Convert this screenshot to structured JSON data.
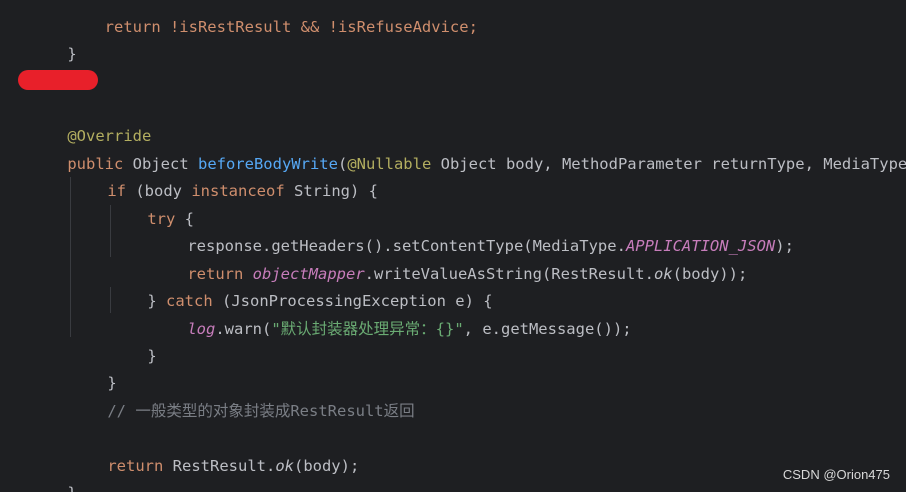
{
  "code": {
    "top_fragment": "    return !isRestResult && !isRefuseAdvice;",
    "line_close_1": "}",
    "annotation": "@Override",
    "sig_public": "public",
    "sig_object": " Object ",
    "sig_method": "beforeBodyWrite",
    "sig_paren": "(",
    "sig_nullable": "@Nullable",
    "sig_rest": " Object body, MethodParameter returnType, MediaType",
    "if_kw": "if",
    "if_mid": " (body ",
    "instanceof_kw": "instanceof",
    "if_end": " String) {",
    "try_kw": "try",
    "try_end": " {",
    "resp_pre": "response.getHeaders().setContentType(MediaType.",
    "resp_const": "APPLICATION_JSON",
    "resp_end": ");",
    "return_kw": "return",
    "ret_sp": " ",
    "ret_field": "objectMapper",
    "ret_mid": ".writeValueAsString(RestResult.",
    "ret_ok": "ok",
    "ret_end": "(body));",
    "catch_pre": "} ",
    "catch_kw": "catch",
    "catch_end": " (JsonProcessingException e) {",
    "log_field": "log",
    "log_mid": ".warn(",
    "log_str": "\"默认封装器处理异常：{}\"",
    "log_end": ", e.getMessage());",
    "close_try": "}",
    "close_if": "}",
    "comment": "// 一般类型的对象封装成RestResult返回",
    "final_return_kw": "return",
    "final_mid": " RestResult.",
    "final_ok": "ok",
    "final_end": "(body);",
    "close_method": "}"
  },
  "watermark": "CSDN @Orion475",
  "colors": {
    "background": "#1e1f22",
    "keyword": "#cf8e6d",
    "annotation": "#b3ae60",
    "method": "#56a8f5",
    "string": "#6aab73",
    "constant": "#c77dbb",
    "comment": "#7a7e85",
    "redaction": "#e8202a"
  }
}
